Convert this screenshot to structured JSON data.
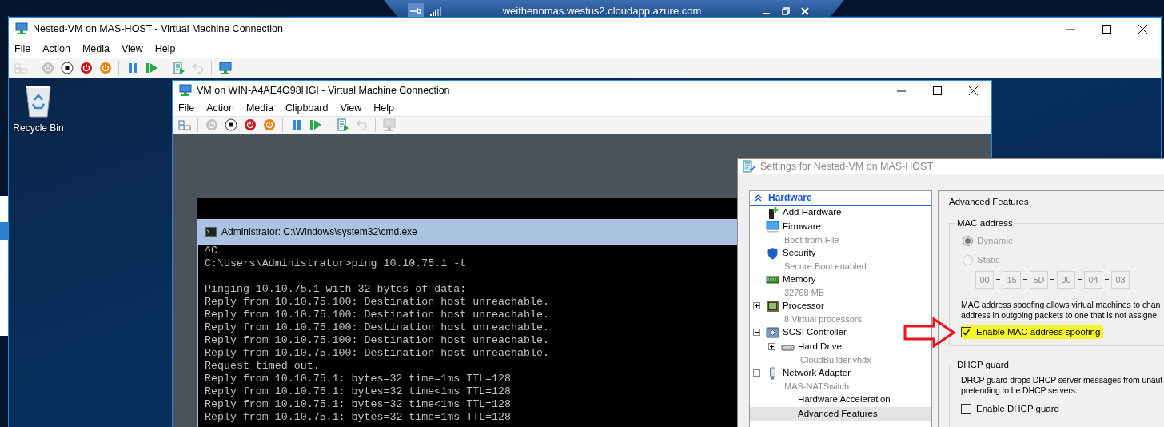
{
  "remote_bar": {
    "host": "weithennmas.westus2.cloudapp.azure.com",
    "pinned": true
  },
  "host_window": {
    "title": "Nested-VM on MAS-HOST - Virtual Machine Connection",
    "menu": [
      "File",
      "Action",
      "Media",
      "View",
      "Help"
    ],
    "toolbar": [
      {
        "kind": "keys",
        "disabled": true
      },
      {
        "kind": "separator"
      },
      {
        "kind": "start",
        "disabled": true
      },
      {
        "kind": "turn-off",
        "disabled": false
      },
      {
        "kind": "shut-down",
        "disabled": false
      },
      {
        "kind": "save",
        "disabled": false
      },
      {
        "kind": "separator"
      },
      {
        "kind": "pause",
        "disabled": false
      },
      {
        "kind": "resume",
        "disabled": false
      },
      {
        "kind": "separator"
      },
      {
        "kind": "checkpoint",
        "disabled": false
      },
      {
        "kind": "revert",
        "disabled": true
      },
      {
        "kind": "separator"
      },
      {
        "kind": "session",
        "disabled": false
      }
    ]
  },
  "desktop_icons": [
    {
      "label": "Recycle Bin"
    }
  ],
  "vm_window": {
    "title": "VM on WIN-A4AE4O98HGI - Virtual Machine Connection",
    "menu": [
      "File",
      "Action",
      "Media",
      "Clipboard",
      "View",
      "Help"
    ],
    "toolbar": [
      {
        "kind": "keys",
        "disabled": false
      },
      {
        "kind": "separator"
      },
      {
        "kind": "start",
        "disabled": true
      },
      {
        "kind": "turn-off",
        "disabled": false
      },
      {
        "kind": "shut-down",
        "disabled": false
      },
      {
        "kind": "save",
        "disabled": false
      },
      {
        "kind": "separator"
      },
      {
        "kind": "pause",
        "disabled": false
      },
      {
        "kind": "resume",
        "disabled": false
      },
      {
        "kind": "separator"
      },
      {
        "kind": "checkpoint",
        "disabled": false
      },
      {
        "kind": "revert",
        "disabled": true
      },
      {
        "kind": "separator"
      },
      {
        "kind": "session",
        "disabled": true
      }
    ]
  },
  "console": {
    "title": "Administrator: C:\\Windows\\system32\\cmd.exe",
    "lines": [
      {
        "kind": "text",
        "text": "^C"
      },
      {
        "kind": "text",
        "text": "C:\\Users\\Administrator>ping 10.10.75.1 -t"
      },
      {
        "kind": "blank"
      },
      {
        "kind": "text",
        "text": "Pinging 10.10.75.1 with 32 bytes of data:"
      },
      {
        "kind": "text",
        "text": "Reply from 10.10.75.100: Destination host unreachable."
      },
      {
        "kind": "text",
        "text": "Reply from 10.10.75.100: Destination host unreachable."
      },
      {
        "kind": "text",
        "text": "Reply from 10.10.75.100: Destination host unreachable."
      },
      {
        "kind": "text",
        "text": "Reply from 10.10.75.100: Destination host unreachable."
      },
      {
        "kind": "text",
        "text": "Reply from 10.10.75.100: Destination host unreachable."
      },
      {
        "kind": "text",
        "text": "Request timed out."
      },
      {
        "kind": "text",
        "text": "Reply from 10.10.75.1: bytes=32 time=1ms TTL=128"
      },
      {
        "kind": "text",
        "text": "Reply from 10.10.75.1: bytes=32 time<1ms TTL=128"
      },
      {
        "kind": "text",
        "text": "Reply from 10.10.75.1: bytes=32 time<1ms TTL=128"
      },
      {
        "kind": "text",
        "text": "Reply from 10.10.75.1: bytes=32 time=1ms TTL=128"
      }
    ]
  },
  "settings": {
    "title": "Settings for Nested-VM on MAS-HOST",
    "tree": {
      "header": "Hardware",
      "expanded": true,
      "items": [
        {
          "label": "Add Hardware",
          "kind": "device",
          "selected": false
        },
        {
          "label": "Firmware",
          "detail": "Boot from File",
          "kind": "device",
          "selected": false
        },
        {
          "label": "Security",
          "detail": "Secure Boot enabled",
          "kind": "device",
          "selected": false
        },
        {
          "label": "Memory",
          "detail": "32768 MB",
          "kind": "device",
          "selected": false
        },
        {
          "label": "Processor",
          "detail": "8 Virtual processors",
          "kind": "device",
          "expanded": false,
          "selected": false
        },
        {
          "label": "SCSI Controller",
          "kind": "device",
          "expanded": true,
          "selected": false,
          "children": [
            {
              "label": "Hard Drive",
              "detail": "CloudBuilder.vhdx",
              "kind": "device",
              "expanded": false,
              "selected": false
            }
          ]
        },
        {
          "label": "Network Adapter",
          "detail": "MAS-NATSwitch",
          "kind": "device",
          "expanded": true,
          "selected": false,
          "children": [
            {
              "label": "Hardware Acceleration",
              "kind": "page",
              "selected": false
            },
            {
              "label": "Advanced Features",
              "kind": "page",
              "selected": true
            }
          ]
        }
      ]
    },
    "details": {
      "title": "Advanced Features",
      "mac_group": {
        "title": "MAC address",
        "disabled": true,
        "options": [
          {
            "label": "Dynamic",
            "selected": true
          },
          {
            "label": "Static",
            "selected": false
          }
        ],
        "octets": [
          "00",
          "15",
          "5D",
          "00",
          "04",
          "03"
        ],
        "description": [
          "MAC address spoofing allows virtual machines to chan",
          "address in outgoing packets to one that is not assigne"
        ],
        "checkbox": {
          "label": "Enable MAC address spoofing",
          "checked": true,
          "highlighted": true
        }
      },
      "dhcp_group": {
        "title": "DHCP guard",
        "description": [
          "DHCP guard drops DHCP server messages from unaut",
          "pretending to be DHCP servers."
        ],
        "checkbox": {
          "label": "Enable DHCP guard",
          "checked": false,
          "highlighted": false
        }
      }
    }
  }
}
